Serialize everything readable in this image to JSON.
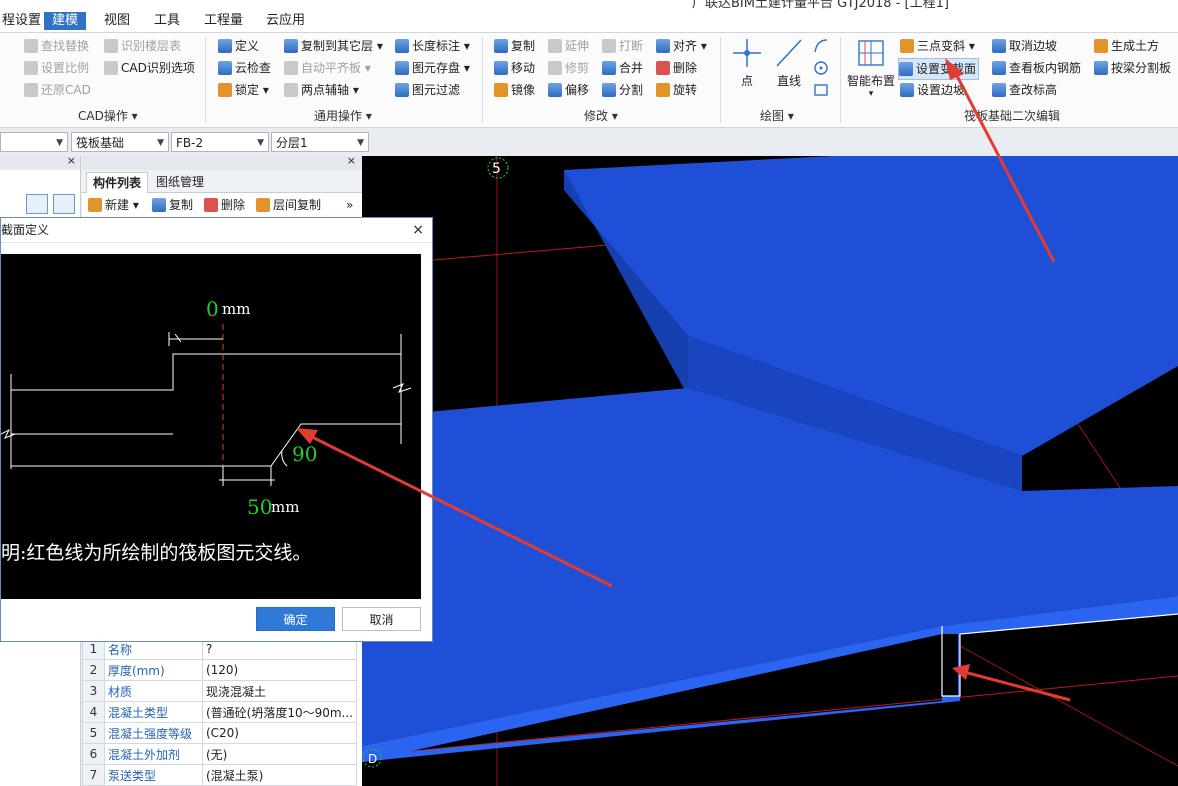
{
  "window": {
    "title": "广联达BIM土建计量平台 GTJ2018 - [工程1]"
  },
  "menu": [
    {
      "label": "程设置",
      "active": false
    },
    {
      "label": "建模",
      "active": true
    },
    {
      "label": "视图",
      "active": false
    },
    {
      "label": "工具",
      "active": false
    },
    {
      "label": "工程量",
      "active": false
    },
    {
      "label": "云应用",
      "active": false
    }
  ],
  "ribbon": {
    "cad": {
      "label": "CAD操作 ▾",
      "b1": "查找替换",
      "b2": "识别楼层表",
      "b3": "设置比例",
      "b4": "CAD识别选项",
      "b5": "还原CAD"
    },
    "common": {
      "label": "通用操作 ▾",
      "b1": "定义",
      "b2": "复制到其它层 ▾",
      "b3": "长度标注 ▾",
      "b4": "云检查",
      "b5": "自动平齐板 ▾",
      "b6": "图元存盘 ▾",
      "b7": "锁定 ▾",
      "b8": "两点辅轴 ▾",
      "b9": "图元过滤"
    },
    "modify": {
      "label": "修改 ▾",
      "b1": "复制",
      "b2": "延伸",
      "b3": "打断",
      "b4": "对齐 ▾",
      "b5": "移动",
      "b6": "修剪",
      "b7": "合并",
      "b8": "删除",
      "b9": "镜像",
      "b10": "偏移",
      "b11": "分割",
      "b12": "旋转"
    },
    "draw": {
      "label": "绘图 ▾",
      "point": "点",
      "line": "直线"
    },
    "raft": {
      "label": "筏板基础二次编辑",
      "smart": "智能布置",
      "b1": "三点变斜 ▾",
      "b2": "取消边坡",
      "b3": "生成土方",
      "b4": "设置变截面",
      "b5": "查看板内钢筋",
      "b6": "按梁分割板",
      "b7": "设置边坡",
      "b8": "查改标高"
    }
  },
  "selectors": {
    "type": "筏板基础",
    "component": "FB-2",
    "layer": "分层1"
  },
  "panel": {
    "tab1": "构件列表",
    "tab2": "图纸管理",
    "new": "新建 ▾",
    "copy": "复制",
    "delete": "删除",
    "layercopy": "层间复制",
    "more": "»"
  },
  "properties": [
    {
      "num": "1",
      "key": "名称",
      "val": "?"
    },
    {
      "num": "2",
      "key": "厚度(mm)",
      "val": "(120)"
    },
    {
      "num": "3",
      "key": "材质",
      "val": "现浇混凝土"
    },
    {
      "num": "4",
      "key": "混凝土类型",
      "val": "(普通砼(坍落度10～90m..."
    },
    {
      "num": "5",
      "key": "混凝土强度等级",
      "val": "(C20)"
    },
    {
      "num": "6",
      "key": "混凝土外加剂",
      "val": "(无)"
    },
    {
      "num": "7",
      "key": "泵送类型",
      "val": "(混凝土泵)"
    }
  ],
  "dialog": {
    "title": "截面定义",
    "close": "×",
    "top_dim": "0",
    "bottom_dim": "50",
    "angle": "90",
    "unit": "mm",
    "note": "明:红色线为所绘制的筏板图元交线。",
    "ok": "确定",
    "cancel": "取消"
  },
  "viewport": {
    "axis_top": "5",
    "axis_bottom": "D"
  },
  "colors": {
    "accent": "#2f73c5",
    "slab": "#1f4fd6",
    "annotation": "#e23b2f",
    "dim_green": "#22d022"
  }
}
